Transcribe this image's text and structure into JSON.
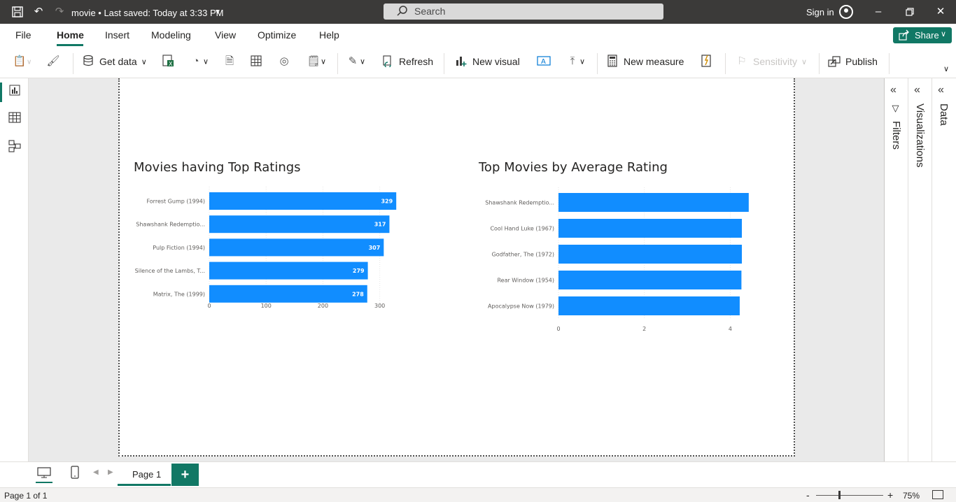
{
  "app": {
    "doc_title": "movie • Last saved: Today at 3:33 PM",
    "search_placeholder": "Search",
    "signin_label": "Sign in"
  },
  "menu": {
    "items": [
      "File",
      "Home",
      "Insert",
      "Modeling",
      "View",
      "Optimize",
      "Help"
    ],
    "active": "Home",
    "share_label": "Share"
  },
  "ribbon": {
    "get_data": "Get data",
    "refresh": "Refresh",
    "new_visual": "New visual",
    "new_measure": "New measure",
    "sensitivity": "Sensitivity",
    "publish": "Publish"
  },
  "panes": {
    "filters": "Filters",
    "visualizations": "Visualizations",
    "data": "Data"
  },
  "tabs": {
    "page_label": "Page 1",
    "add_label": "+"
  },
  "status": {
    "page_info": "Page 1 of 1",
    "zoom_minus": "-",
    "zoom_plus": "+",
    "zoom": "75%"
  },
  "colors": {
    "accent": "#117865",
    "bar": "#118dff",
    "titlebar": "#3b3a39"
  },
  "chart_data": [
    {
      "type": "bar",
      "orientation": "horizontal",
      "title": "Movies having Top Ratings",
      "categories": [
        "Forrest Gump (1994)",
        "Shawshank Redemptio...",
        "Pulp Fiction (1994)",
        "Silence of the Lambs, T...",
        "Matrix, The (1999)"
      ],
      "values": [
        329,
        317,
        307,
        279,
        278
      ],
      "data_labels": [
        "329",
        "317",
        "307",
        "279",
        "278"
      ],
      "xticks": [
        "0",
        "100",
        "200",
        "300"
      ],
      "xlim": [
        0,
        330
      ],
      "grid": true,
      "color": "#118dff"
    },
    {
      "type": "bar",
      "orientation": "horizontal",
      "title": "Top Movies by Average Rating",
      "categories": [
        "Shawshank Redemptio...",
        "Cool Hand Luke (1967)",
        "Godfather, The (1972)",
        "Rear Window (1954)",
        "Apocalypse Now (1979)"
      ],
      "values": [
        4.43,
        4.27,
        4.27,
        4.26,
        4.22
      ],
      "xticks": [
        "0",
        "2",
        "4"
      ],
      "xlim": [
        0,
        4.4
      ],
      "grid": true,
      "color": "#118dff"
    }
  ]
}
